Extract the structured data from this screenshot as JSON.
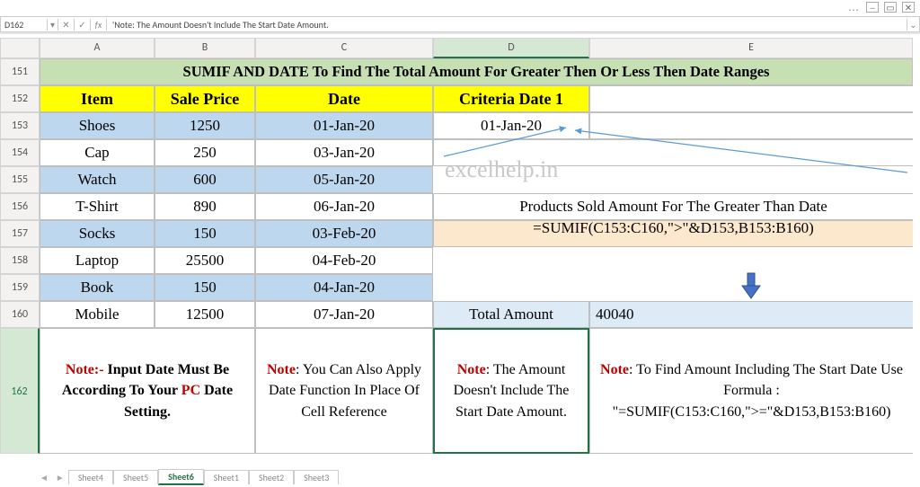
{
  "namebox": "D162",
  "formula_bar": "'Note: The Amount Doesn't Include The Start Date Amount.",
  "columns": [
    "A",
    "B",
    "C",
    "D",
    "E"
  ],
  "rows": [
    "151",
    "152",
    "153",
    "154",
    "155",
    "156",
    "157",
    "158",
    "159",
    "160",
    "162"
  ],
  "title": "SUMIF AND DATE To Find The Total Amount For Greater Then Or Less Then Date Ranges",
  "headers": {
    "item": "Item",
    "price": "Sale Price",
    "date": "Date",
    "crit": "Criteria Date 1"
  },
  "criteria_date": "01-Jan-20",
  "caption": "Products Sold Amount For The Greater Than Date",
  "formula_display": "=SUMIF(C153:C160,\">\"&D153,B153:B160)",
  "total_label": "Total Amount",
  "total_value": "40040",
  "watermark": "excelhelp.in",
  "data": [
    {
      "item": "Shoes",
      "price": "1250",
      "date": "01-Jan-20"
    },
    {
      "item": "Cap",
      "price": "250",
      "date": "03-Jan-20"
    },
    {
      "item": "Watch",
      "price": "600",
      "date": "05-Jan-20"
    },
    {
      "item": "T-Shirt",
      "price": "890",
      "date": "06-Jan-20"
    },
    {
      "item": "Socks",
      "price": "150",
      "date": "03-Feb-20"
    },
    {
      "item": "Laptop",
      "price": "25500",
      "date": "04-Feb-20"
    },
    {
      "item": "Book",
      "price": "150",
      "date": "04-Jan-20"
    },
    {
      "item": "Mobile",
      "price": "12500",
      "date": "07-Jan-20"
    }
  ],
  "notes": {
    "a": {
      "label": "Note:-",
      "text": " Input Date Must Be According To Your ",
      "pc": "PC",
      "tail": " Date Setting."
    },
    "c": {
      "label": "Note",
      "text": ": You Can Also Apply Date Function In Place Of Cell Reference"
    },
    "d": {
      "label": "Note",
      "text": ": The Amount Doesn't Include The Start Date Amount."
    },
    "e": {
      "label": "Note",
      "text": ": To Find Amount Including The Start Date Use Formula : \"=SUMIF(C153:C160,\">=\"&D153,B153:B160)"
    }
  },
  "sheets": [
    "Sheet4",
    "Sheet5",
    "Sheet6",
    "Sheet1",
    "Sheet2",
    "Sheet3"
  ],
  "active_sheet": "Sheet6",
  "chart_data": {
    "type": "table",
    "title": "SUMIF AND DATE example",
    "columns": [
      "Item",
      "Sale Price",
      "Date"
    ],
    "rows": [
      [
        "Shoes",
        1250,
        "01-Jan-20"
      ],
      [
        "Cap",
        250,
        "03-Jan-20"
      ],
      [
        "Watch",
        600,
        "05-Jan-20"
      ],
      [
        "T-Shirt",
        890,
        "06-Jan-20"
      ],
      [
        "Socks",
        150,
        "03-Feb-20"
      ],
      [
        "Laptop",
        25500,
        "04-Feb-20"
      ],
      [
        "Book",
        150,
        "04-Jan-20"
      ],
      [
        "Mobile",
        12500,
        "07-Jan-20"
      ]
    ],
    "criteria_date": "01-Jan-20",
    "formula": "=SUMIF(C153:C160,\">\"&D153,B153:B160)",
    "result": 40040
  }
}
